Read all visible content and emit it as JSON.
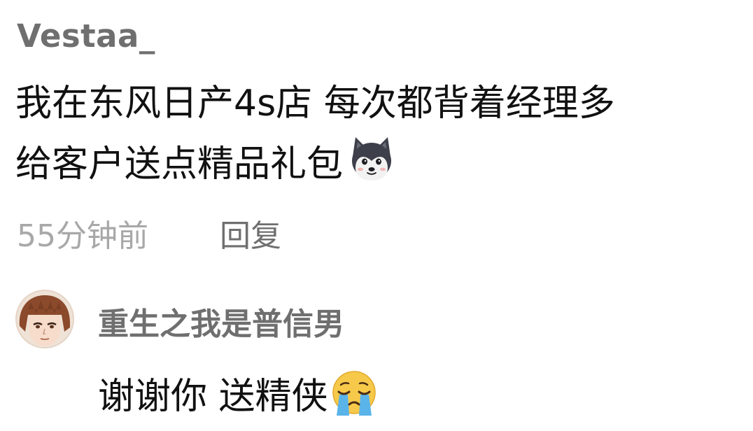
{
  "comment": {
    "username": "Vestaa_",
    "text_line1": "我在东风日产4s店 每次都背着经理多",
    "text_line2": "给客户送点精品礼包",
    "emoji": "dog-face-emoji",
    "timestamp": "55分钟前",
    "reply_label": "回复"
  },
  "reply": {
    "avatar": "anime-boy-avatar",
    "username": "重生之我是普信男",
    "text": "谢谢你 送精侠",
    "emoji": "crying-face-emoji"
  },
  "colors": {
    "username": "#6f6f6f",
    "body_text": "#111111",
    "meta_text": "#a8a8a8",
    "background": "#ffffff",
    "cry_emoji_face": "#f6c94a",
    "cry_emoji_tears": "#5ab4ea"
  }
}
